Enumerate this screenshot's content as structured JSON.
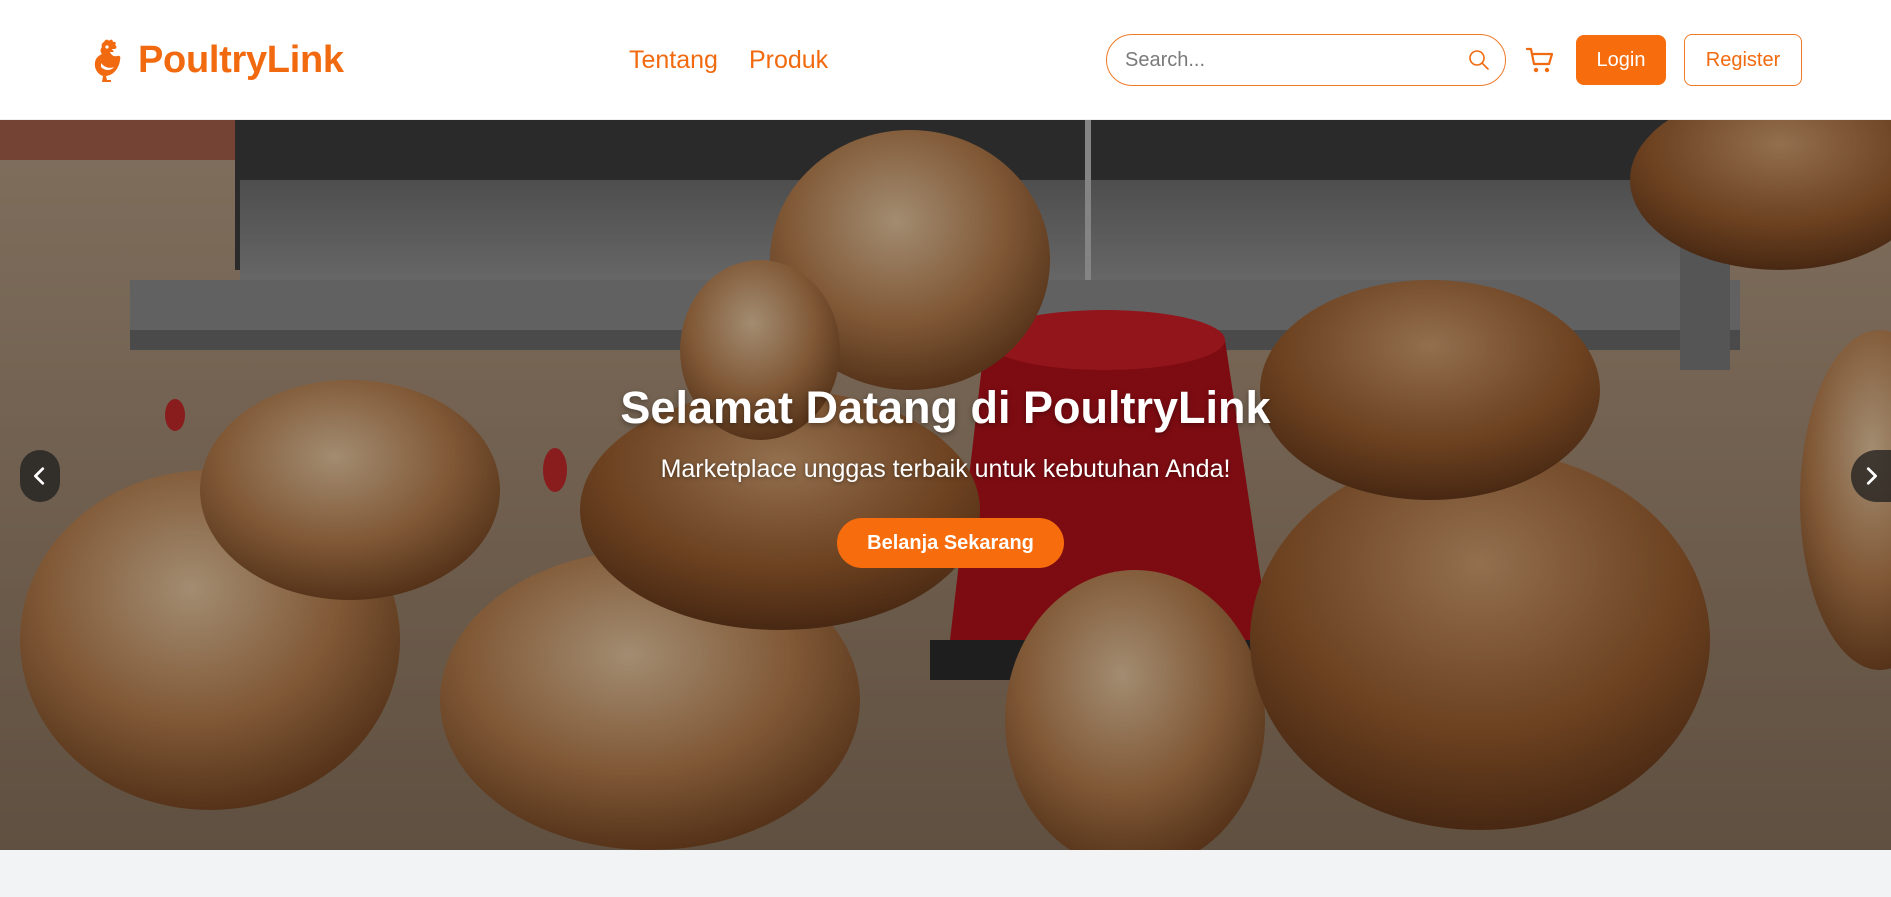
{
  "brand": {
    "name": "PoultryLink",
    "icon": "rooster-icon"
  },
  "nav": {
    "links": [
      {
        "label": "Tentang"
      },
      {
        "label": "Produk"
      }
    ]
  },
  "search": {
    "placeholder": "Search...",
    "value": "",
    "icon": "search-icon"
  },
  "cart": {
    "icon": "cart-icon"
  },
  "auth": {
    "login_label": "Login",
    "register_label": "Register"
  },
  "hero": {
    "title": "Selamat Datang di PoultryLink",
    "subtitle": "Marketplace unggas terbaik untuk kebutuhan Anda!",
    "cta_label": "Belanja Sekarang",
    "image": "photo of brown hens eating around a red feeder in a barn",
    "prev_icon": "chevron-left-icon",
    "next_icon": "chevron-right-icon"
  },
  "colors": {
    "accent": "#f76c0c",
    "brand_text": "#f26a0f",
    "overlay": "rgba(0,0,0,0.30)",
    "section_bg": "#f2f3f5"
  }
}
